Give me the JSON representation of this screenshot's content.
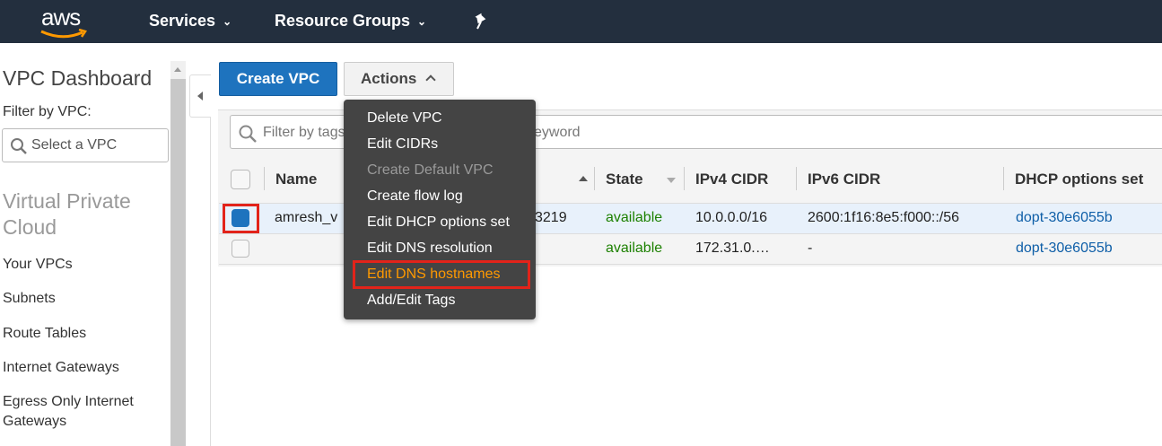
{
  "topnav": {
    "logo": "aws",
    "services": "Services",
    "resource_groups": "Resource Groups",
    "pin_icon": "pin-icon"
  },
  "sidebar": {
    "title": "VPC Dashboard",
    "filter_label": "Filter by VPC:",
    "select_placeholder": "Select a VPC",
    "section": "Virtual Private Cloud",
    "links": [
      "Your VPCs",
      "Subnets",
      "Route Tables",
      "Internet Gateways",
      "Egress Only Internet Gateways"
    ]
  },
  "toolbar": {
    "create_label": "Create VPC",
    "actions_label": "Actions"
  },
  "filter": {
    "placeholder_left": "Filter by tags",
    "placeholder_right": "eyword"
  },
  "table": {
    "headers": {
      "name": "Name",
      "state": "State",
      "ipv4": "IPv4 CIDR",
      "ipv6": "IPv6 CIDR",
      "dhcp": "DHCP options set"
    },
    "rows": [
      {
        "name": "amresh_v",
        "vpc_id_fragment": "3219",
        "state": "available",
        "ipv4": "10.0.0.0/16",
        "ipv6": "2600:1f16:8e5:f000::/56",
        "dhcp": "dopt-30e6055b",
        "selected": true
      },
      {
        "name": "",
        "vpc_id_fragment": "",
        "state": "available",
        "ipv4": "172.31.0.…",
        "ipv6": "-",
        "dhcp": "dopt-30e6055b",
        "selected": false
      }
    ]
  },
  "menu": {
    "items": [
      {
        "label": "Delete VPC",
        "state": "enabled"
      },
      {
        "label": "Edit CIDRs",
        "state": "enabled"
      },
      {
        "label": "Create Default VPC",
        "state": "disabled"
      },
      {
        "label": "Create flow log",
        "state": "enabled"
      },
      {
        "label": "Edit DHCP options set",
        "state": "enabled"
      },
      {
        "label": "Edit DNS resolution",
        "state": "enabled"
      },
      {
        "label": "Edit DNS hostnames",
        "state": "highlighted"
      },
      {
        "label": "Add/Edit Tags",
        "state": "enabled"
      }
    ]
  },
  "colors": {
    "nav_bg": "#232f3e",
    "primary": "#1e73be",
    "available": "#1d8102",
    "link": "#0f5fa8",
    "highlight": "#ff9900",
    "annotation": "#e2231a"
  }
}
